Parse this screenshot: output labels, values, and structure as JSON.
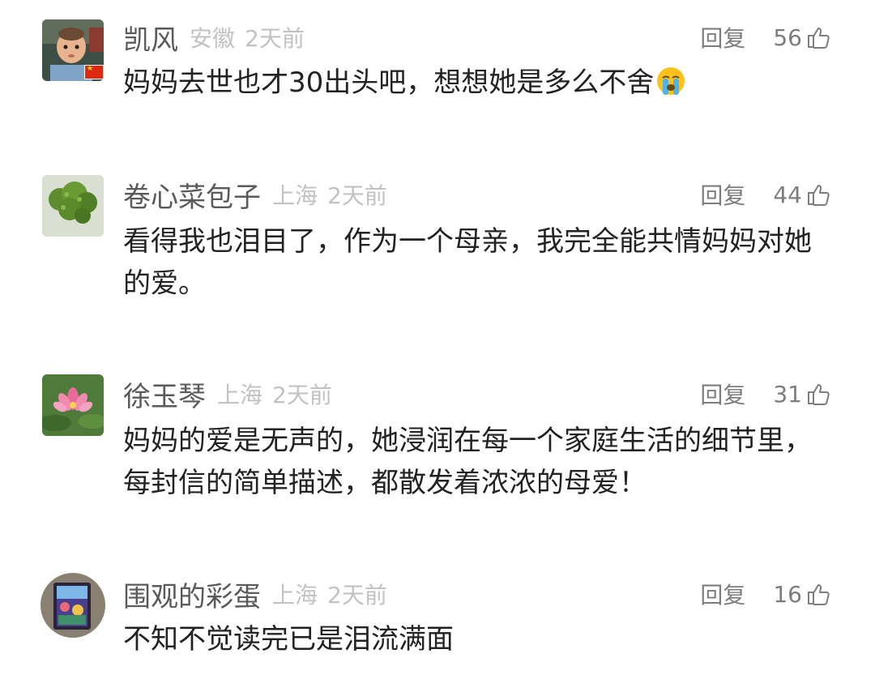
{
  "comments": [
    {
      "author": "凯风",
      "region": "安徽",
      "time": "2天前",
      "reply_label": "回复",
      "likes": "56",
      "text": "妈妈去世也才30出头吧，想想她是多么不舍",
      "emoji": "crying-face-icon",
      "avatar": "baby-photo-avatar"
    },
    {
      "author": "卷心菜包子",
      "region": "上海",
      "time": "2天前",
      "reply_label": "回复",
      "likes": "44",
      "text": "看得我也泪目了，作为一个母亲，我完全能共情妈妈对她的爱。",
      "avatar": "broccoli-avatar"
    },
    {
      "author": "徐玉琴",
      "region": "上海",
      "time": "2天前",
      "reply_label": "回复",
      "likes": "31",
      "text": "妈妈的爱是无声的，她浸润在每一个家庭生活的细节里，每封信的简单描述，都散发着浓浓的母爱！",
      "avatar": "lotus-flower-avatar"
    },
    {
      "author": "围观的彩蛋",
      "region": "上海",
      "time": "2天前",
      "reply_label": "回复",
      "likes": "16",
      "text": "不知不觉读完已是泪流满面",
      "avatar": "painting-avatar"
    }
  ],
  "colors": {
    "name": "#5a5a5a",
    "meta": "#c2c2c2",
    "action": "#7d7d7d",
    "text": "#222222"
  }
}
